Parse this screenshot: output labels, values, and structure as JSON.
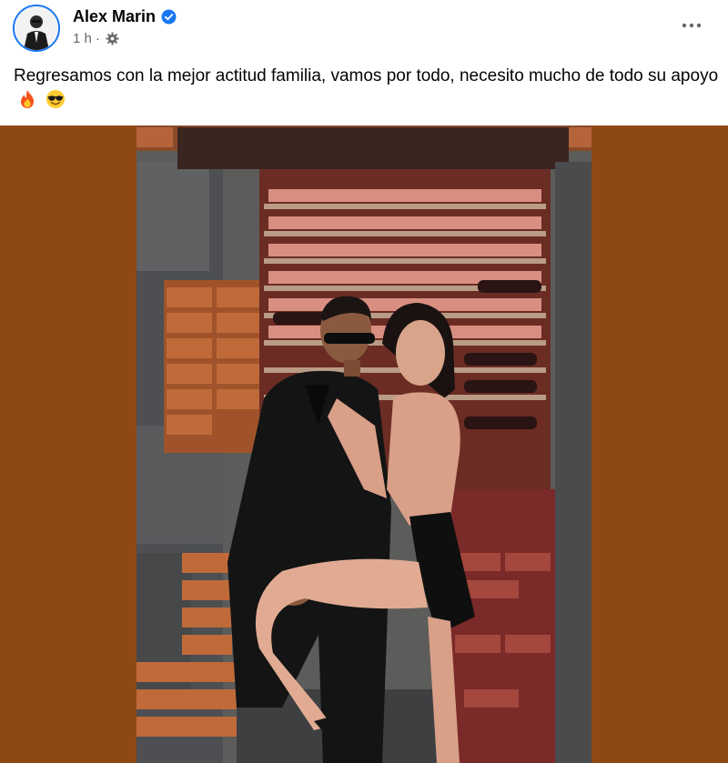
{
  "post": {
    "author": "Alex Marin",
    "verified": true,
    "time": "1 h",
    "separator": "·",
    "audience_icon": "gear-icon",
    "more_icon": "more-horizontal-icon",
    "caption": "Regresamos con la mejor actitud familia, vamos por todo, necesito mucho de todo su apoyo",
    "caption_emojis": [
      "fire-emoji",
      "sunglasses-emoji"
    ]
  },
  "colors": {
    "photo_background": "#8e4813",
    "verified_blue": "#1877f2",
    "meta_gray": "#65676b"
  }
}
